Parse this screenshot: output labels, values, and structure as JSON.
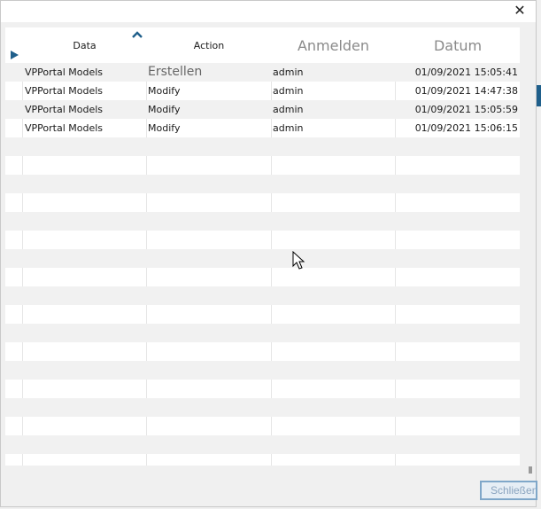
{
  "dialog": {
    "close_glyph": "✕",
    "close_button_label": "Schließen"
  },
  "grid": {
    "columns": [
      {
        "label": "Data"
      },
      {
        "label": "Action"
      },
      {
        "label": "Anmelden"
      },
      {
        "label": "Datum"
      }
    ],
    "rows": [
      {
        "data": "VPPortal Models",
        "action": "Erstellen",
        "login": "admin",
        "date": "01/09/2021 15:05:41"
      },
      {
        "data": "VPPortal Models",
        "action": "Modify",
        "login": "admin",
        "date": "01/09/2021 14:47:38"
      },
      {
        "data": "VPPortal Models",
        "action": "Modify",
        "login": "admin",
        "date": "01/09/2021 15:05:59"
      },
      {
        "data": "VPPortal Models",
        "action": "Modify",
        "login": "admin",
        "date": "01/09/2021 15:06:15"
      }
    ],
    "empty_row_count": 19
  },
  "colors": {
    "accent": "#1f5f8b",
    "alt_row": "#f1f1f1"
  }
}
